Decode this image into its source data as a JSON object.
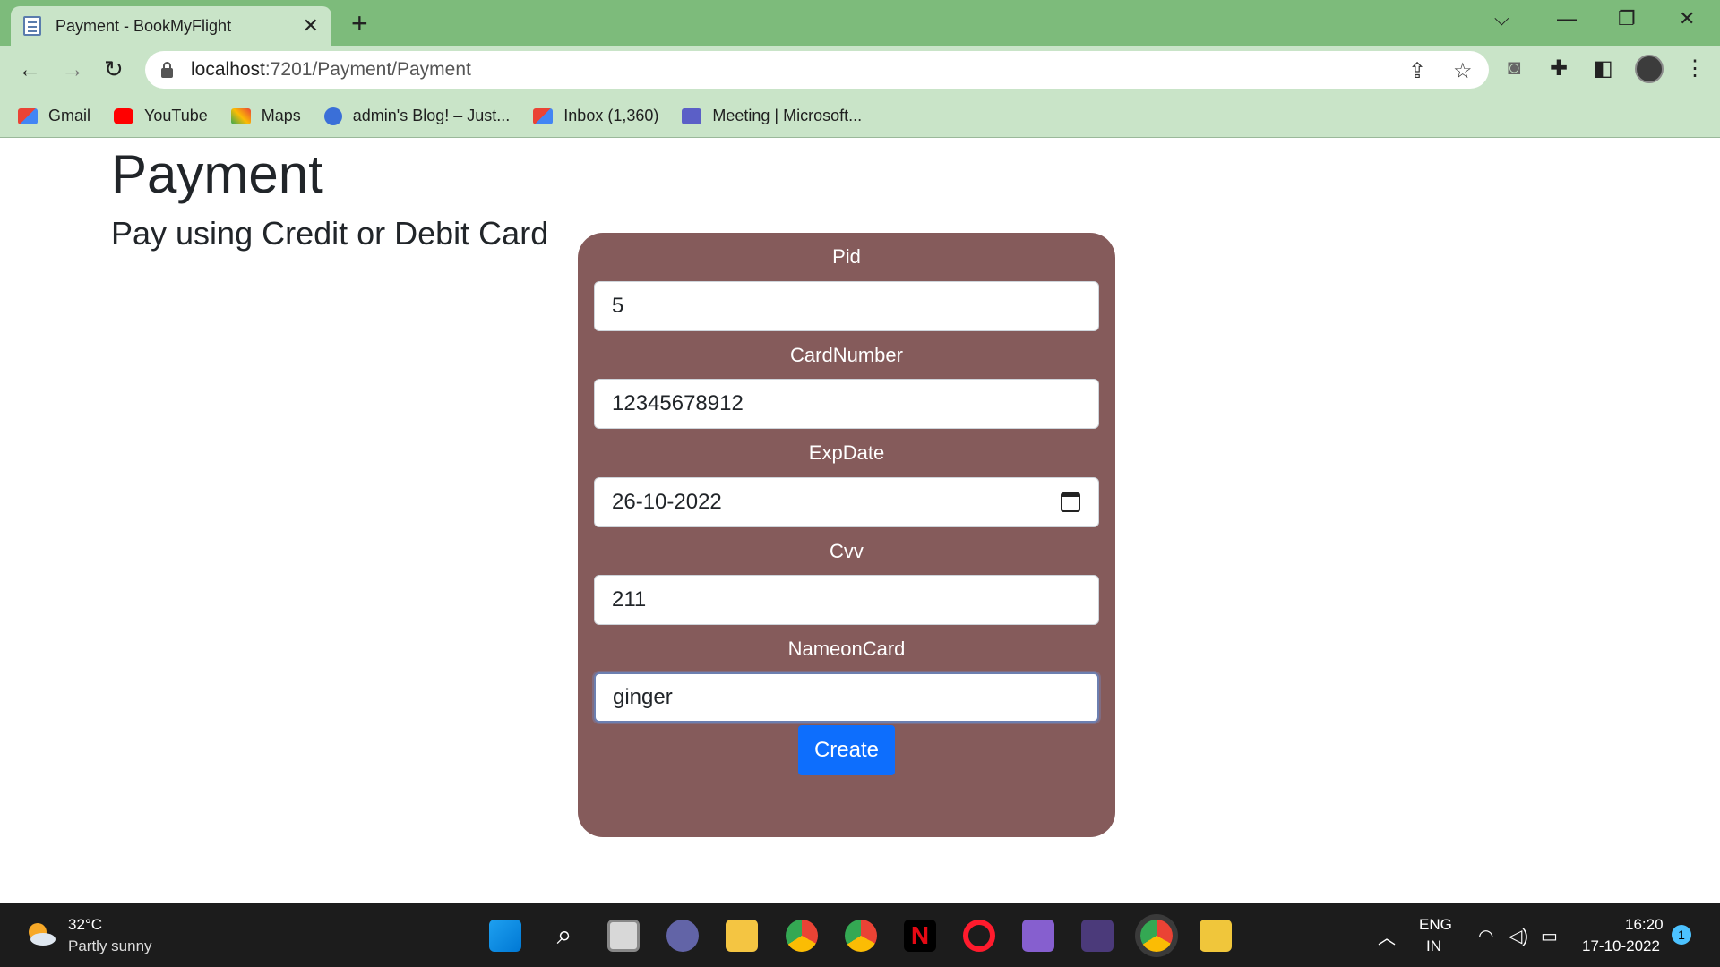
{
  "browser": {
    "tab_title": "Payment - BookMyFlight",
    "url_host": "localhost",
    "url_path": ":7201/Payment/Payment",
    "bookmarks": [
      {
        "label": "Gmail",
        "icon": "gmail-icon"
      },
      {
        "label": "YouTube",
        "icon": "youtube-icon"
      },
      {
        "label": "Maps",
        "icon": "maps-icon"
      },
      {
        "label": "admin's Blog! – Just...",
        "icon": "blog-icon"
      },
      {
        "label": "Inbox (1,360)",
        "icon": "gmail-icon"
      },
      {
        "label": "Meeting | Microsoft...",
        "icon": "teams-icon"
      }
    ]
  },
  "page": {
    "title": "Payment",
    "subtitle": "Pay using Credit or Debit Card"
  },
  "form": {
    "fields": [
      {
        "label": "Pid",
        "value": "5"
      },
      {
        "label": "CardNumber",
        "value": "12345678912"
      },
      {
        "label": "ExpDate",
        "value": "26-10-2022"
      },
      {
        "label": "Cvv",
        "value": "211"
      },
      {
        "label": "NameonCard",
        "value": "ginger"
      }
    ],
    "submit_label": "Create",
    "card_color": "#855b5b",
    "button_color": "#0d6efd"
  },
  "taskbar": {
    "weather_temp": "32°C",
    "weather_desc": "Partly sunny",
    "lang_line1": "ENG",
    "lang_line2": "IN",
    "time": "16:20",
    "date": "17-10-2022",
    "notification_count": "1"
  }
}
